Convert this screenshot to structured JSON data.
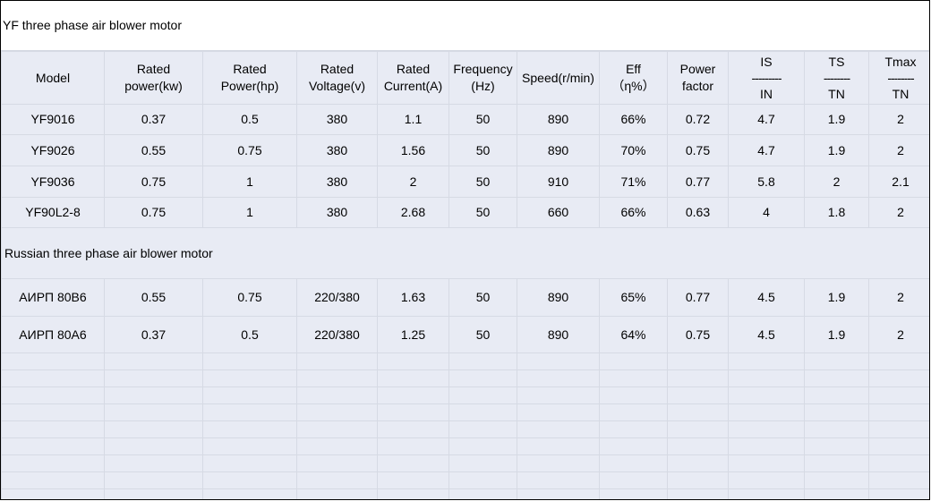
{
  "title": "YF three phase air blower motor",
  "headers": {
    "model": "Model",
    "rated_power_kw": [
      "Rated",
      "power(kw)"
    ],
    "rated_power_hp": [
      "Rated",
      "Power(hp)"
    ],
    "rated_voltage": [
      "Rated",
      "Voltage(v)"
    ],
    "rated_current": [
      "Rated",
      "Current(A)"
    ],
    "frequency": [
      "Frequency",
      "(Hz)"
    ],
    "speed": "Speed(r/min)",
    "eff": [
      "Eff",
      "（η%）"
    ],
    "power_factor": [
      "Power",
      "factor"
    ],
    "is_in": [
      "IS",
      "---------",
      "IN"
    ],
    "ts_tn": [
      "TS",
      "--------",
      "TN"
    ],
    "tmax_tn": [
      "Tmax",
      "--------",
      "TN"
    ]
  },
  "yf_rows": [
    [
      "YF9016",
      "0.37",
      "0.5",
      "380",
      "1.1",
      "50",
      "890",
      "66%",
      "0.72",
      "4.7",
      "1.9",
      "2"
    ],
    [
      "YF9026",
      "0.55",
      "0.75",
      "380",
      "1.56",
      "50",
      "890",
      "70%",
      "0.75",
      "4.7",
      "1.9",
      "2"
    ],
    [
      "YF9036",
      "0.75",
      "1",
      "380",
      "2",
      "50",
      "910",
      "71%",
      "0.77",
      "5.8",
      "2",
      "2.1"
    ],
    [
      "YF90L2-8",
      "0.75",
      "1",
      "380",
      "2.68",
      "50",
      "660",
      "66%",
      "0.63",
      "4",
      "1.8",
      "2"
    ]
  ],
  "russian_title": "Russian three phase air blower motor",
  "russian_rows": [
    [
      "АИРП 80B6",
      "0.55",
      "0.75",
      "220/380",
      "1.63",
      "50",
      "890",
      "65%",
      "0.77",
      "4.5",
      "1.9",
      "2"
    ],
    [
      "АИРП 80A6",
      "0.37",
      "0.5",
      "220/380",
      "1.25",
      "50",
      "890",
      "64%",
      "0.75",
      "4.5",
      "1.9",
      "2"
    ]
  ]
}
